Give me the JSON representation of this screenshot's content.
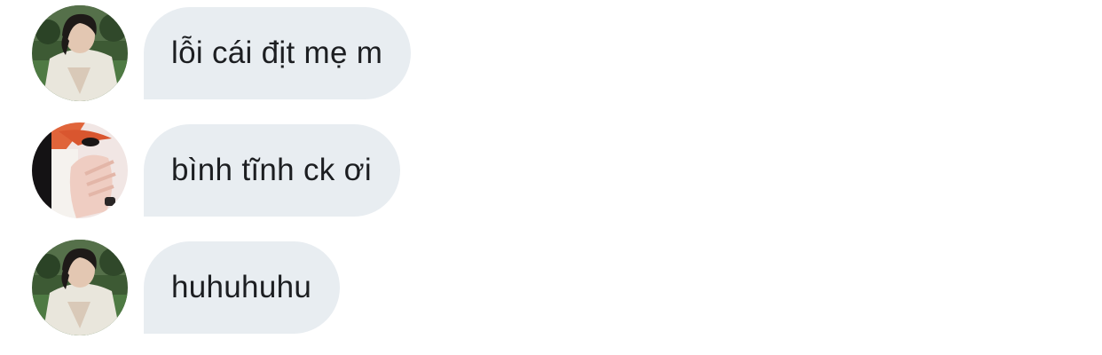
{
  "messages": [
    {
      "text": "lỗi cái địt mẹ m",
      "avatar": "avatar-dark-hair"
    },
    {
      "text": "bình tĩnh ck ơi",
      "avatar": "avatar-orange-hair"
    },
    {
      "text": "huhuhuhu",
      "avatar": "avatar-dark-hair"
    }
  ],
  "colors": {
    "bubble": "#e8edf1",
    "text": "#1c1e21"
  }
}
